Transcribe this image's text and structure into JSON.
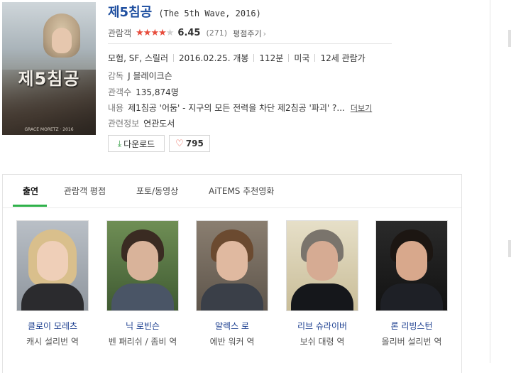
{
  "movie": {
    "title": "제5침공",
    "original_title": "(The 5th Wave, 2016)",
    "poster_title": "제5침공",
    "poster_credit": "GRACE MORETZ · 2016",
    "rating_label": "관람객",
    "rating_stars": 3.5,
    "score": "6.45",
    "rating_count": "(271)",
    "rate_link": "평점주기",
    "meta": [
      "모험, SF, 스릴러",
      "2016.02.25. 개봉",
      "112분",
      "미국",
      "12세 관람가"
    ],
    "director_label": "감독",
    "director": "J 블레이크슨",
    "audience_label": "관객수",
    "audience": "135,874명",
    "synopsis_label": "내용",
    "synopsis": "제1침공 '어둠' - 지구의 모든 전력을 차단 제2침공 '파괴' ?...",
    "more_label": "더보기",
    "related_label": "관련정보",
    "related": "연관도서",
    "download_label": "다운로드",
    "like_count": "795"
  },
  "tabs": [
    "출연",
    "관람객 평점",
    "포토/동영상",
    "AiTEMS 추천영화"
  ],
  "active_tab": 0,
  "cast": [
    {
      "name": "클로이 모레츠",
      "role": "캐시 설리번 역"
    },
    {
      "name": "닉 로빈슨",
      "role": "벤 패리쉬 / 좀비 역"
    },
    {
      "name": "알렉스 로",
      "role": "에반 워커 역"
    },
    {
      "name": "리브 슈라이버",
      "role": "보쉬 대령 역"
    },
    {
      "name": "론 리빙스턴",
      "role": "올리버 설리번 역"
    }
  ],
  "colors": {
    "title_blue": "#1f4fa0",
    "star_red": "#e74c3c",
    "tab_green": "#2fb14a",
    "cast_name_blue": "#1a3d8f"
  },
  "icons": {
    "download": "download-arrow-icon",
    "like": "heart-icon",
    "star": "star-icon"
  }
}
